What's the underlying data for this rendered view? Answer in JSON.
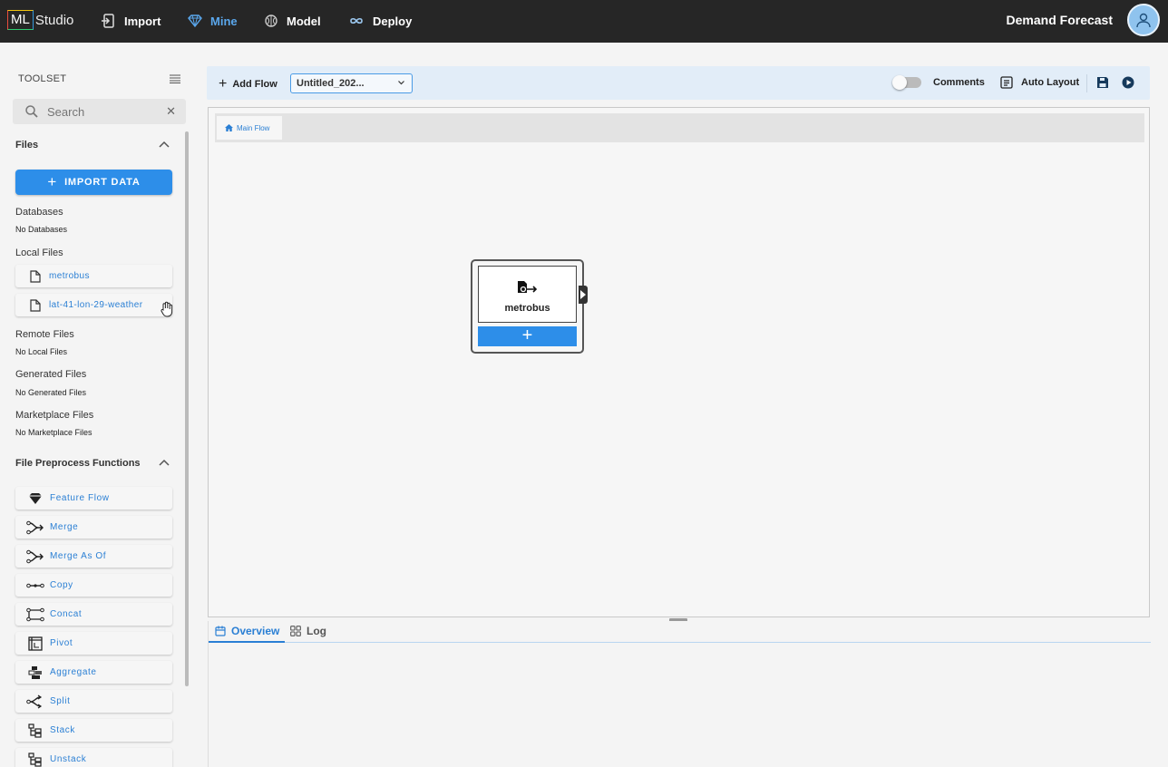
{
  "app": {
    "logo_box": "ML",
    "logo_text": "Studio",
    "project_title": "Demand Forecast"
  },
  "nav": [
    {
      "label": "Import",
      "icon": "import-icon",
      "active": false
    },
    {
      "label": "Mine",
      "icon": "diamond-icon",
      "active": true
    },
    {
      "label": "Model",
      "icon": "brain-icon",
      "active": false
    },
    {
      "label": "Deploy",
      "icon": "infinity-icon",
      "active": false
    }
  ],
  "sidebar": {
    "toolset_label": "TOOLSET",
    "search_placeholder": "Search",
    "files_section": "Files",
    "import_button": "IMPORT DATA",
    "databases_title": "Databases",
    "databases_empty": "No Databases",
    "local_files_title": "Local Files",
    "local_files": [
      "metrobus",
      "lat-41-lon-29-weather"
    ],
    "remote_files_title": "Remote Files",
    "remote_files_empty": "No Local Files",
    "generated_files_title": "Generated Files",
    "generated_files_empty": "No Generated Files",
    "marketplace_files_title": "Marketplace Files",
    "marketplace_files_empty": "No Marketplace Files",
    "preprocess_section": "File Preprocess Functions",
    "functions": [
      {
        "label": "Feature Flow",
        "icon": "diamond-icon"
      },
      {
        "label": "Merge",
        "icon": "merge-icon"
      },
      {
        "label": "Merge As Of",
        "icon": "merge-as-of-icon"
      },
      {
        "label": "Copy",
        "icon": "copy-icon"
      },
      {
        "label": "Concat",
        "icon": "concat-icon"
      },
      {
        "label": "Pivot",
        "icon": "pivot-icon"
      },
      {
        "label": "Aggregate",
        "icon": "aggregate-icon"
      },
      {
        "label": "Split",
        "icon": "split-icon"
      },
      {
        "label": "Stack",
        "icon": "stack-icon"
      },
      {
        "label": "Unstack",
        "icon": "unstack-icon"
      }
    ]
  },
  "toolbar": {
    "add_flow": "Add Flow",
    "flow_select": "Untitled_202...",
    "comments": "Comments",
    "auto_layout": "Auto Layout"
  },
  "canvas": {
    "tab": "Main Flow",
    "node_label": "metrobus",
    "node_add": "+"
  },
  "bottom": {
    "tab_overview": "Overview",
    "tab_log": "Log"
  }
}
